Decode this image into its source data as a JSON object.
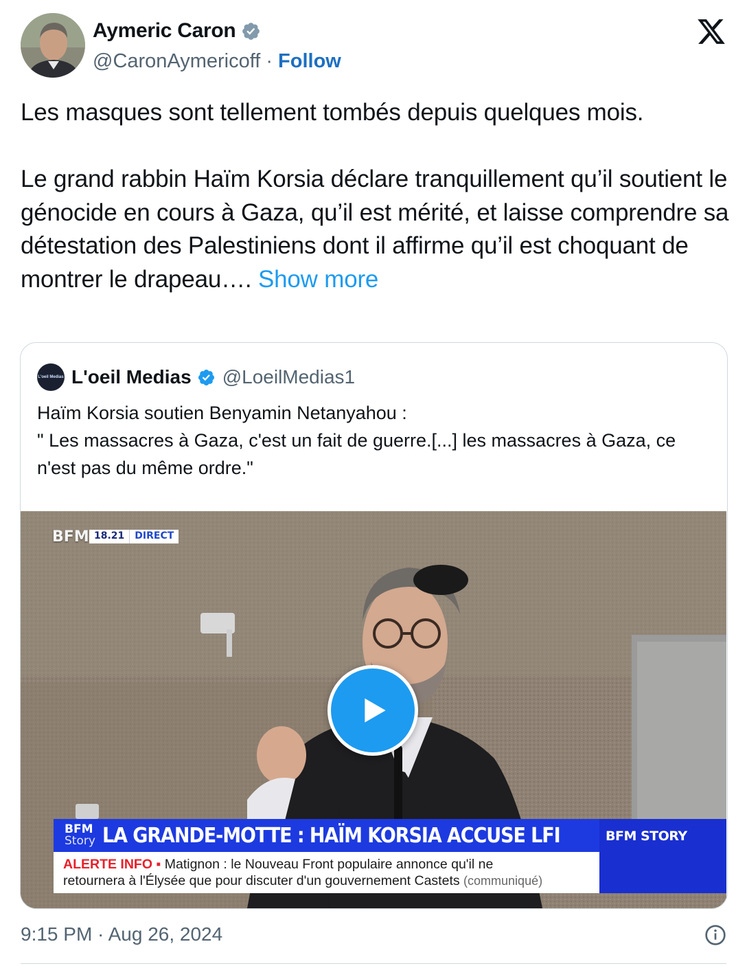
{
  "author": {
    "name": "Aymeric Caron",
    "handle": "@CaronAymericoff",
    "separator": "·",
    "follow_label": "Follow",
    "verified": true
  },
  "tweet": {
    "paragraph_1": "Les masques sont tellement tombés depuis quelques mois.",
    "paragraph_2": "Le grand rabbin Haïm Korsia déclare tranquillement qu’il soutient le génocide en cours à Gaza, qu’il est mérité, et laisse comprendre sa détestation des Palestiniens dont il affirme qu’il est choquant de montrer le drapeau….",
    "show_more": "Show more",
    "timestamp": "9:15 PM · Aug 26, 2024"
  },
  "quoted_tweet": {
    "name": "L'oeil Medias",
    "handle": "@LoeilMedias1",
    "avatar_text": "L'oeil Medias",
    "verified": true,
    "text_line_1": "Haïm Korsia soutien Benyamin Netanyahou  :",
    "text_line_2": "\" Les massacres à Gaza, c'est un fait de guerre.[...] les massacres à Gaza, ce n'est pas du même ordre.\""
  },
  "video": {
    "channel_logo": "BFM TV.",
    "live_time": "18.21",
    "live_label": "DIRECT",
    "story_logo_top": "BFM",
    "story_logo_bottom": "Story",
    "headline": "LA GRANDE-MOTTE : HAÏM KORSIA ACCUSE LFI",
    "alert_label": "ALERTE INFO ▪",
    "ticker_line_1": "Matignon : le Nouveau Front populaire annonce qu'il ne",
    "ticker_line_2": "retournera à l'Élysée que pour discuter d'un gouvernement Castets",
    "ticker_source": "(communiqué)",
    "story_tag": "BFM STORY"
  },
  "icons": {
    "verified": "verified-badge-icon",
    "x_logo": "x-logo-icon",
    "play": "play-icon",
    "info": "info-icon"
  },
  "colors": {
    "link": "#1d9bf0",
    "follow": "#1d6fc2",
    "secondary_text": "#536471",
    "banner_blue": "#1d3ae0",
    "alert_red": "#e8202b"
  }
}
